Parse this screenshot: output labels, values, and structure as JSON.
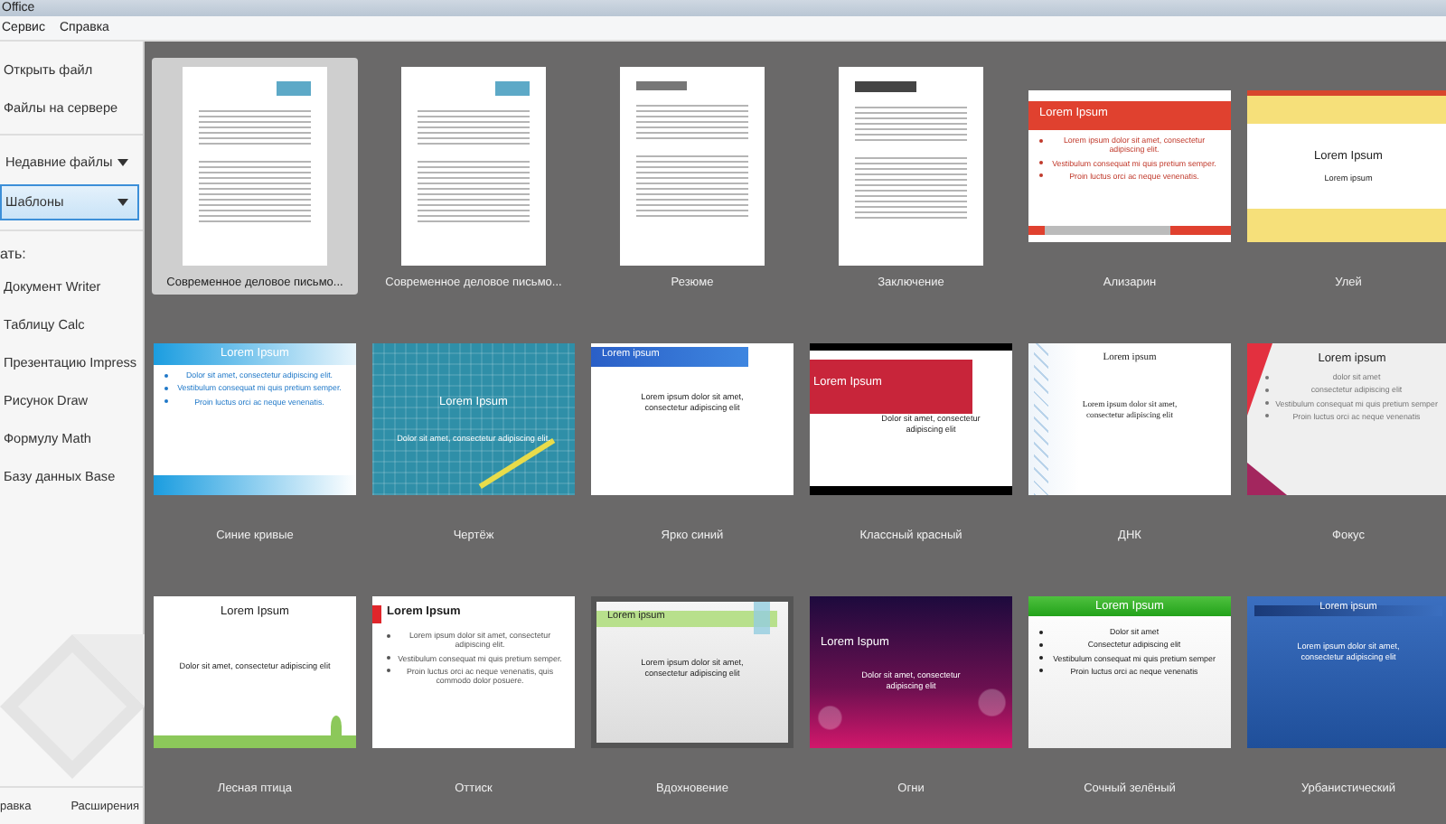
{
  "window": {
    "title": "Office"
  },
  "menu": [
    "Сервис",
    "Справка"
  ],
  "sidebar": {
    "links": [
      "Открыть файл",
      "Файлы на сервере"
    ],
    "dropdowns": [
      {
        "label": "Недавние файлы",
        "selected": false
      },
      {
        "label": "Шаблоны",
        "selected": true
      }
    ],
    "create_heading": "ать:",
    "create_items": [
      "Документ Writer",
      "Таблицу Calc",
      "Презентацию Impress",
      "Рисунок Draw",
      "Формулу Math",
      "Базу данных Base"
    ],
    "footer": [
      "равка",
      "Расширения"
    ]
  },
  "templates": [
    {
      "label": "Современное деловое письмо...",
      "selected": true,
      "kind": "letter"
    },
    {
      "label": "Современное деловое письмо...",
      "selected": false,
      "kind": "letter"
    },
    {
      "label": "Резюме",
      "selected": false,
      "kind": "resume"
    },
    {
      "label": "Заключение",
      "selected": false,
      "kind": "memo"
    },
    {
      "label": "Ализарин",
      "selected": false,
      "kind": "redbar",
      "title": "Lorem Ipsum",
      "bullets": [
        "Lorem ipsum dolor sit amet, consectetur adipiscing elit.",
        "Vestibulum consequat mi quis pretium semper.",
        "Proin luctus orci ac neque venenatis."
      ]
    },
    {
      "label": "Улей",
      "selected": false,
      "kind": "hexagons",
      "title": "Lorem Ipsum",
      "body": "Lorem ipsum"
    },
    {
      "label": "Синие кривые",
      "selected": false,
      "kind": "bluefade",
      "title": "Lorem Ipsum",
      "bullets": [
        "Dolor sit amet, consectetur adipiscing elit.",
        "Vestibulum consequat mi quis pretium semper.",
        "Proin luctus orci ac neque venenatis."
      ]
    },
    {
      "label": "Чертёж",
      "selected": false,
      "kind": "grid",
      "title": "Lorem Ipsum",
      "body": "Dolor sit amet, consectetur adipiscing elit."
    },
    {
      "label": "Ярко синий",
      "selected": false,
      "kind": "bluetab",
      "title": "Lorem ipsum",
      "body": "Lorem ipsum dolor sit amet, consectetur adipiscing elit"
    },
    {
      "label": "Классный красный",
      "selected": false,
      "kind": "redblock",
      "title": "Lorem Ipsum",
      "body": "Dolor sit amet, consectetur adipiscing elit"
    },
    {
      "label": "ДНК",
      "selected": false,
      "kind": "helix",
      "title": "Lorem ipsum",
      "body": "Lorem ipsum dolor sit amet, consectetur adipiscing elit"
    },
    {
      "label": "Фокус",
      "selected": false,
      "kind": "corners",
      "title": "Lorem ipsum",
      "bullets": [
        "dolor sit amet",
        "consectetur adipiscing elit",
        "Vestibulum consequat mi quis pretium semper",
        "Proin luctus orci ac neque venenatis"
      ]
    },
    {
      "label": "Лесная птица",
      "selected": false,
      "kind": "meadow",
      "title": "Lorem Ipsum",
      "body": "Dolor sit amet, consectetur adipiscing elit"
    },
    {
      "label": "Оттиск",
      "selected": false,
      "kind": "redmark",
      "title": "Lorem Ipsum",
      "bullets": [
        "Lorem ipsum dolor sit amet, consectetur adipiscing elit.",
        "Vestibulum consequat mi quis pretium semper.",
        "Proin luctus orci ac neque venenatis, quis commodo dolor posuere."
      ]
    },
    {
      "label": "Вдохновение",
      "selected": false,
      "kind": "greentab",
      "title": "Lorem ipsum",
      "body": "Lorem ipsum dolor sit amet, consectetur adipiscing elit"
    },
    {
      "label": "Огни",
      "selected": false,
      "kind": "bokeh",
      "title": "Lorem Ispum",
      "body": "Dolor sit amet, consectetur adipiscing elit"
    },
    {
      "label": "Сочный зелёный",
      "selected": false,
      "kind": "greenhead",
      "title": "Lorem Ipsum",
      "bullets": [
        "Dolor sit amet",
        "Consectetur adipiscing elit",
        "Vestibulum consequat mi quis pretium semper",
        "Proin luctus orci ac neque venenatis"
      ]
    },
    {
      "label": "Урбанистический",
      "selected": false,
      "kind": "bluebanner",
      "title": "Lorem ipsum",
      "body": "Lorem ipsum dolor sit amet, consectetur adipiscing elit"
    }
  ]
}
